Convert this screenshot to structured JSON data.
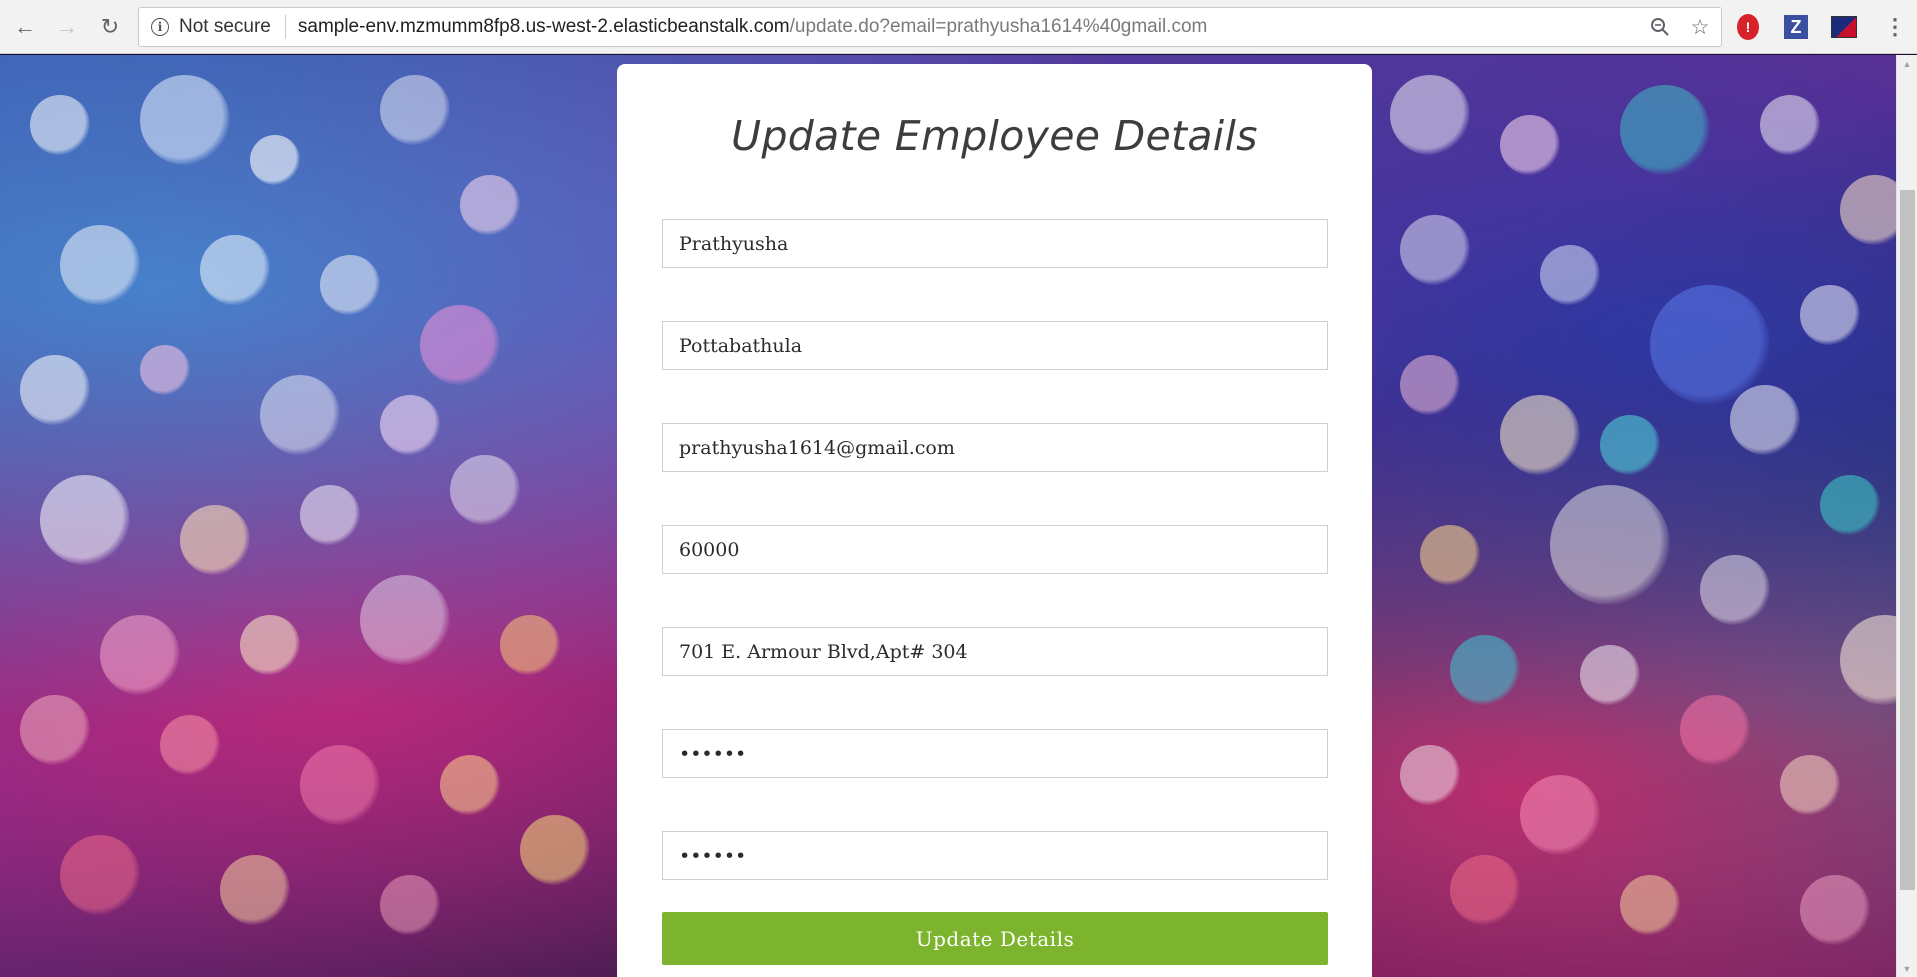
{
  "browser": {
    "back_icon": "arrow-left-icon",
    "forward_icon": "arrow-right-icon",
    "reload_icon": "reload-icon",
    "security_icon": "info-circle-icon",
    "security_label": "Not secure",
    "url_host": "sample-env.mzmumm8fp8.us-west-2.elasticbeanstalk.com",
    "url_path": "/update.do?email=prathyusha1614%40gmail.com",
    "zoom_icon": "zoom-icon",
    "bookmark_icon": "star-icon",
    "extensions": [
      {
        "name": "red-shield-extension-icon",
        "glyph": "!"
      },
      {
        "name": "z-extension-icon",
        "glyph": "Z"
      },
      {
        "name": "flag-extension-icon",
        "glyph": ""
      }
    ],
    "menu_icon": "more-vertical-icon"
  },
  "form": {
    "title": "Update Employee Details",
    "first_name": "Prathyusha",
    "last_name": "Pottabathula",
    "email": "prathyusha1614@gmail.com",
    "salary": "60000",
    "address": "701 E. Armour Blvd,Apt# 304",
    "password": "••••••",
    "confirm_password": "••••••",
    "submit_label": "Update Details",
    "accent_color": "#7cb52d"
  }
}
